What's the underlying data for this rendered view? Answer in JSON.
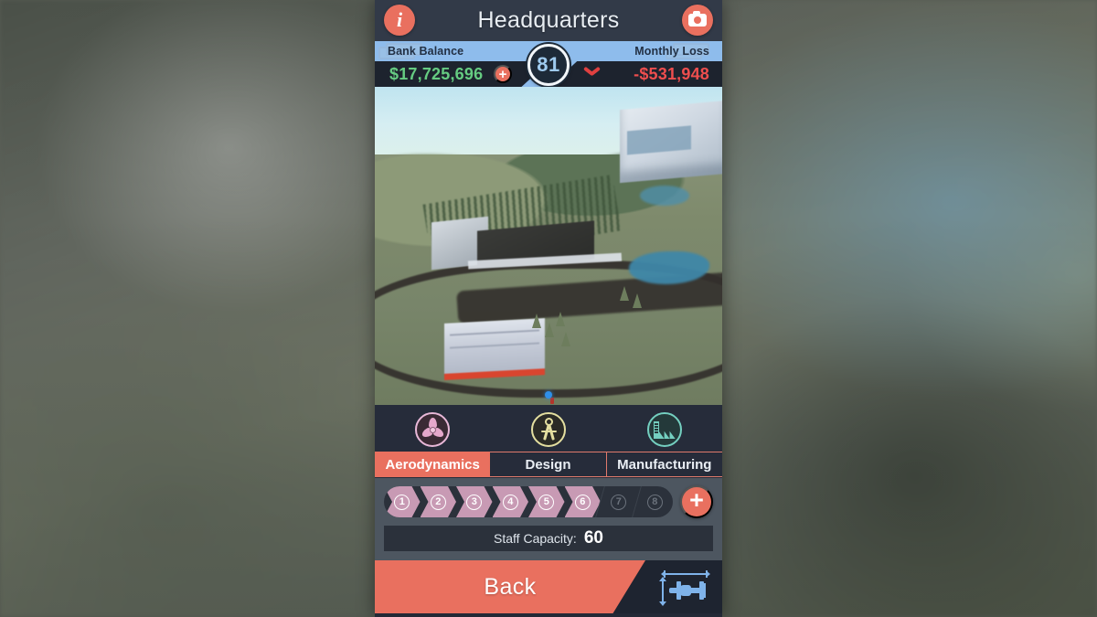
{
  "app": {
    "title": "Headquarters"
  },
  "titlebar": {
    "info_icon": "info-icon",
    "camera_icon": "camera-icon",
    "info_glyph": "i"
  },
  "stats": {
    "bank_label": "Bank Balance",
    "bank_value": "$17,725,696",
    "loss_label": "Monthly Loss",
    "loss_value": "-$531,948",
    "rating": "81",
    "add_funds_glyph": "+",
    "trend_icon": "chevron-down-icon"
  },
  "tabs": [
    {
      "label": "Aerodynamics",
      "icon": "fan-icon",
      "active": true,
      "accent": "#e5a8cc"
    },
    {
      "label": "Design",
      "icon": "compass-icon",
      "active": false,
      "accent": "#e4dfa0"
    },
    {
      "label": "Manufacturing",
      "icon": "factory-icon",
      "active": false,
      "accent": "#74cfc0"
    }
  ],
  "levels": {
    "total": 8,
    "filled": 6,
    "pips": [
      "1",
      "2",
      "3",
      "4",
      "5",
      "6",
      "7",
      "8"
    ],
    "upgrade_glyph": "+"
  },
  "capacity": {
    "label": "Staff Capacity:",
    "value": "60"
  },
  "footer": {
    "back_label": "Back",
    "car_icon": "car-dimensions-icon"
  },
  "colors": {
    "accent": "#e9705f",
    "bank_positive": "#66cc82",
    "loss_negative": "#ef4e4e",
    "money_bar": "#8ebcec",
    "panel_dark": "#262c3a",
    "rating_text": "#9fcbef"
  }
}
